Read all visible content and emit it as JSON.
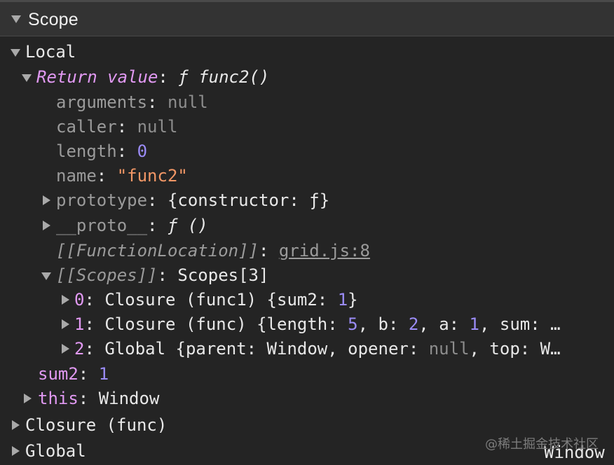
{
  "panel": {
    "title": "Scope"
  },
  "rows": {
    "local": "Local",
    "return_key": "Return value",
    "return_value": "ƒ func2()",
    "arguments_key": "arguments",
    "arguments_val": "null",
    "caller_key": "caller",
    "caller_val": "null",
    "length_key": "length",
    "length_val": "0",
    "name_key": "name",
    "name_val": "\"func2\"",
    "prototype_key": "prototype",
    "prototype_val": "{constructor: ƒ}",
    "proto_key": "__proto__",
    "proto_val": "ƒ ()",
    "funcloc_key": "[[FunctionLocation]]",
    "funcloc_val": "grid.js:8",
    "scopes_key": "[[Scopes]]",
    "scopes_val": "Scopes[3]",
    "scope0_key": "0",
    "scope0_a": "Closure (func1) {sum2: ",
    "scope0_n": "1",
    "scope0_b": "}",
    "scope1_key": "1",
    "scope1_a": "Closure (func) {length: ",
    "scope1_n1": "5",
    "scope1_b": ", b: ",
    "scope1_n2": "2",
    "scope1_c": ", a: ",
    "scope1_n3": "1",
    "scope1_d": ", sum: …",
    "scope2_key": "2",
    "scope2_a": "Global {parent: Window, opener: ",
    "scope2_null": "null",
    "scope2_b": ", top: W…",
    "sum2_key": "sum2",
    "sum2_val": "1",
    "this_key": "this",
    "this_val": "Window",
    "closure": "Closure (func)",
    "global": "Global",
    "global_val": "Window"
  },
  "watermark": "@稀土掘金技术社区",
  "colors": {
    "background": "#242424",
    "header": "#333333",
    "purple_key": "#e199f2",
    "number": "#9b8cf7",
    "string": "#f29766"
  },
  "icons": [
    "expand-down-icon",
    "collapse-right-icon"
  ]
}
